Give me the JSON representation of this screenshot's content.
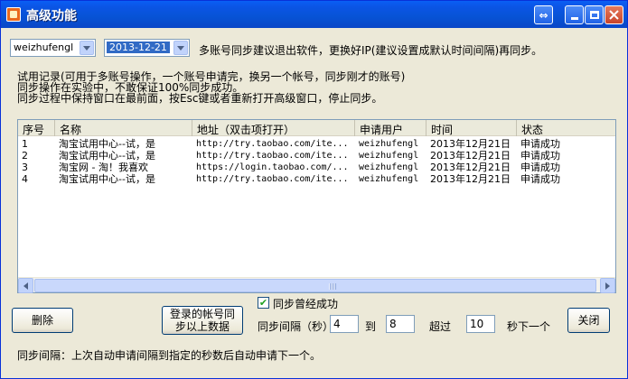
{
  "window": {
    "title": "高级功能"
  },
  "titlebar": {
    "swap_glyph": "⇔"
  },
  "top": {
    "account": "weizhufengl",
    "date": "2013-12-21",
    "notice": "多账号同步建议退出软件，更换好IP(建议设置成默认时间间隔)再同步。"
  },
  "info": {
    "line1": "试用记录(可用于多账号操作，一个账号申请完，换另一个帐号，同步刚才的账号)",
    "line2": "同步操作在实验中，不敢保证100%同步成功。",
    "line3": "同步过程中保持窗口在最前面，按Esc键或者重新打开高级窗口，停止同步。"
  },
  "table": {
    "columns": [
      "序号",
      "名称",
      "地址（双击项打开）",
      "申请用户",
      "时间",
      "状态"
    ],
    "rows": [
      [
        "1",
        "淘宝试用中心--试，是",
        "http://try.taobao.com/ite...",
        "weizhufengl",
        "2013年12月21日",
        "申请成功"
      ],
      [
        "2",
        "淘宝试用中心--试，是",
        "http://try.taobao.com/ite...",
        "weizhufengl",
        "2013年12月21日",
        "申请成功"
      ],
      [
        "3",
        "淘宝网 - 淘！我喜欢",
        "https://login.taobao.com/...",
        "weizhufengl",
        "2013年12月21日",
        "申请成功"
      ],
      [
        "4",
        "淘宝试用中心--试，是",
        "http://try.taobao.com/ite...",
        "weizhufengl",
        "2013年12月21日",
        "申请成功"
      ]
    ]
  },
  "controls": {
    "delete_label": "删除",
    "sync_label_1": "登录的帐号同",
    "sync_label_2": "步以上数据",
    "sync_success_label": "同步曾经成功",
    "sync_success_checked": true,
    "interval_label": "同步间隔（秒）",
    "interval_from": "4",
    "to_label": "到",
    "interval_to": "8",
    "over_label": "超过",
    "over_value": "10",
    "next_label": "秒下一个",
    "close_label": "关闭"
  },
  "footer": {
    "hint": "同步间隔：上次自动申请间隔到指定的秒数后自动申请下一个。"
  }
}
